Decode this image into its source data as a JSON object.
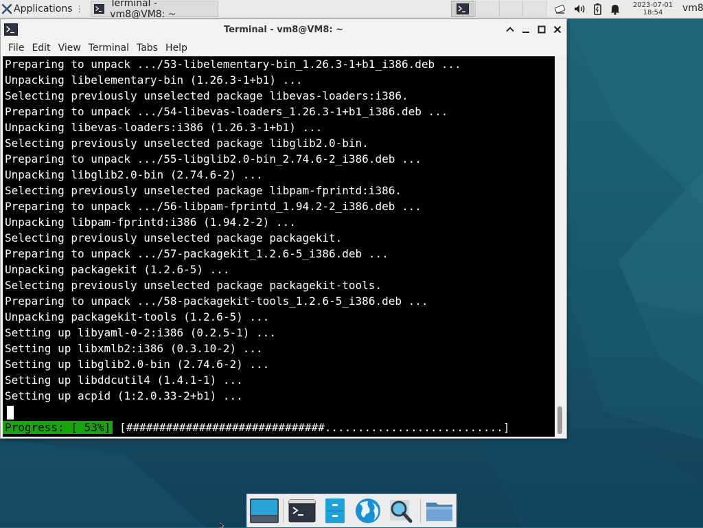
{
  "top_panel": {
    "applications_label": "Applications",
    "task_title": "Terminal - vm8@VM8: ~",
    "clock_date": "2023-07-01",
    "clock_time": "18:54",
    "username": "vm8"
  },
  "window": {
    "title": "Terminal - vm8@VM8: ~",
    "menu": [
      "File",
      "Edit",
      "View",
      "Terminal",
      "Tabs",
      "Help"
    ]
  },
  "terminal": {
    "lines": [
      "Preparing to unpack .../53-libelementary-bin_1.26.3-1+b1_i386.deb ...",
      "Unpacking libelementary-bin (1.26.3-1+b1) ...",
      "Selecting previously unselected package libevas-loaders:i386.",
      "Preparing to unpack .../54-libevas-loaders_1.26.3-1+b1_i386.deb ...",
      "Unpacking libevas-loaders:i386 (1.26.3-1+b1) ...",
      "Selecting previously unselected package libglib2.0-bin.",
      "Preparing to unpack .../55-libglib2.0-bin_2.74.6-2_i386.deb ...",
      "Unpacking libglib2.0-bin (2.74.6-2) ...",
      "Selecting previously unselected package libpam-fprintd:i386.",
      "Preparing to unpack .../56-libpam-fprintd_1.94.2-2_i386.deb ...",
      "Unpacking libpam-fprintd:i386 (1.94.2-2) ...",
      "Selecting previously unselected package packagekit.",
      "Preparing to unpack .../57-packagekit_1.2.6-5_i386.deb ...",
      "Unpacking packagekit (1.2.6-5) ...",
      "Selecting previously unselected package packagekit-tools.",
      "Preparing to unpack .../58-packagekit-tools_1.2.6-5_i386.deb ...",
      "Unpacking packagekit-tools (1.2.6-5) ...",
      "Setting up libyaml-0-2:i386 (0.2.5-1) ...",
      "Setting up libxmlb2:i386 (0.3.10-2) ...",
      "Setting up libglib2.0-bin (2.74.6-2) ...",
      "Setting up libddcutil4 (1.4.1-1) ...",
      "Setting up acpid (1:2.0.33-2+b1) ..."
    ],
    "progress_label": "Progress: [ 53%]",
    "progress_bar": "[##############################...........................]",
    "progress_value": 0.53
  },
  "colors": {
    "progress_green": "#19a30f",
    "terminal_bg": "#000000",
    "terminal_fg": "#ffffff",
    "desktop_bg": "#1b5d73"
  },
  "icons": {
    "applications": "xfce-logo-icon",
    "network": "network-icon",
    "volume": "volume-icon",
    "battery": "battery-icon",
    "notifications": "bell-icon",
    "dock": [
      "show-desktop-icon",
      "terminal-icon",
      "file-cabinet-icon",
      "web-browser-icon",
      "search-icon",
      "folder-icon"
    ]
  }
}
